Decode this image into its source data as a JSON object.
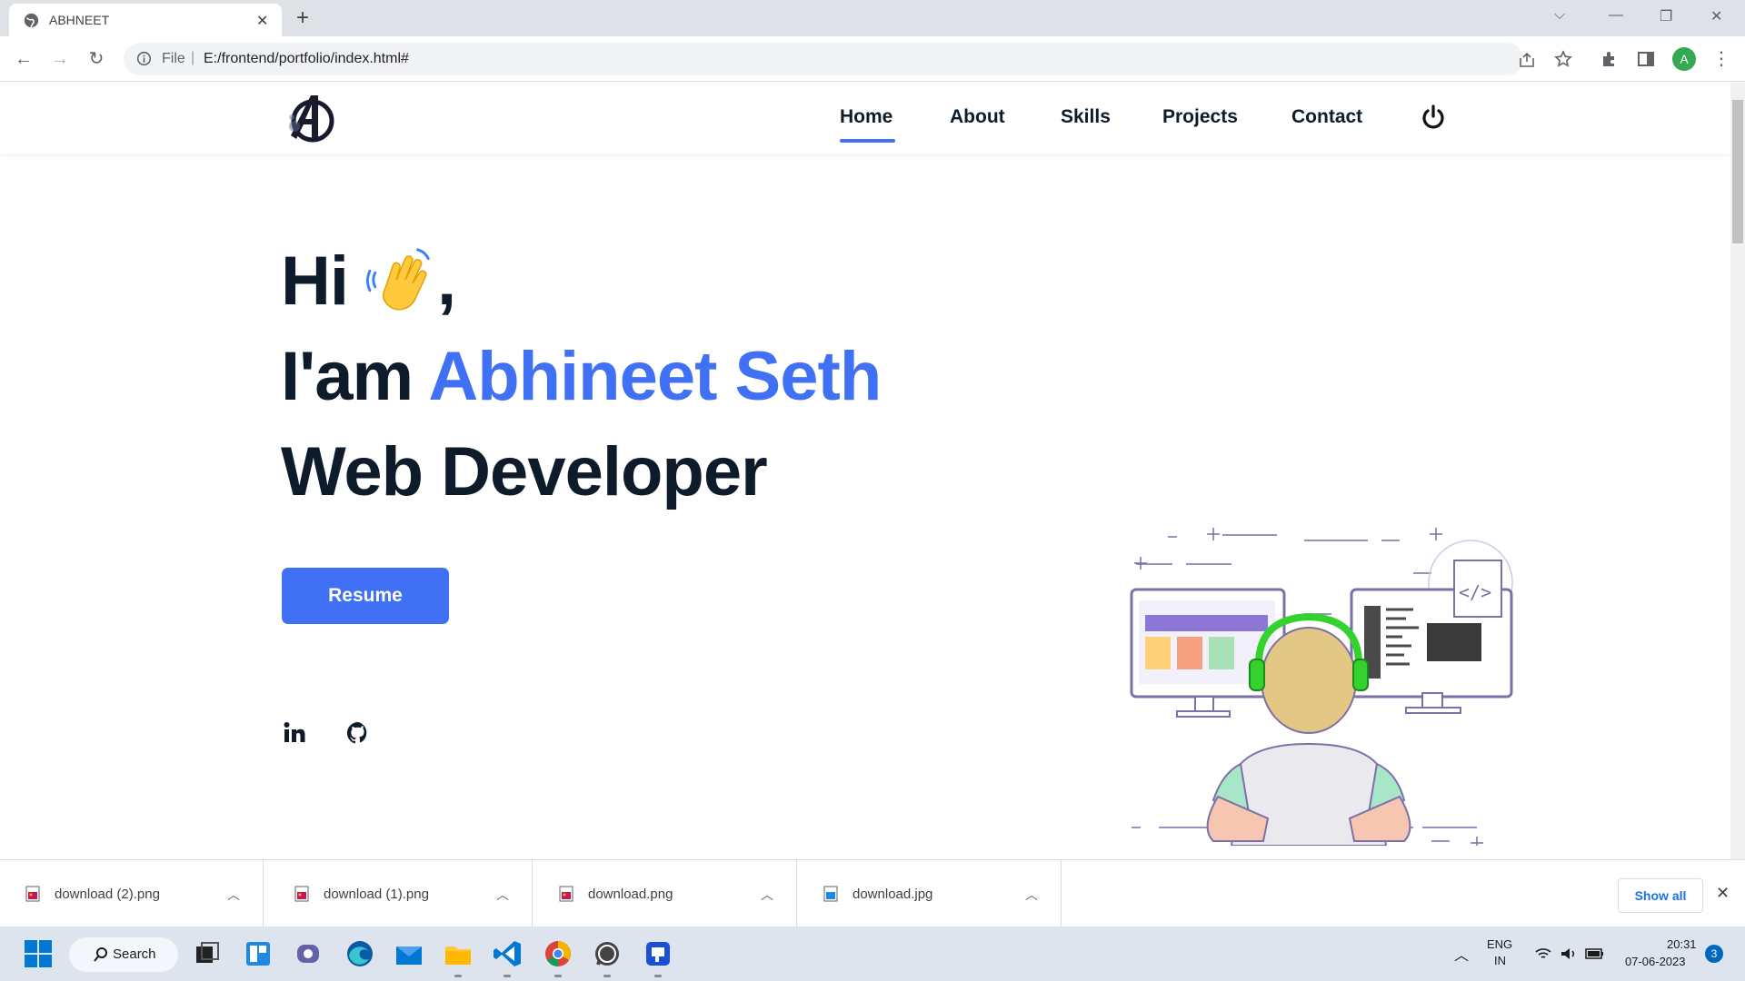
{
  "browser": {
    "tab_title": "ABHNEET",
    "address_scheme": "File",
    "address_url": "E:/frontend/portfolio/index.html#",
    "profile_initial": "A"
  },
  "site": {
    "nav": [
      "Home",
      "About",
      "Skills",
      "Projects",
      "Contact"
    ],
    "active_nav": "Home",
    "accent_color": "#4070f4",
    "text_color": "#0d1b2a"
  },
  "hero": {
    "hi_text": "Hi",
    "hi_comma": ",",
    "intro_prefix": "I'am",
    "name": "Abhineet Seth",
    "role": "Web Developer",
    "resume_label": "Resume",
    "wave_emoji_icon": "waving-hand-icon",
    "social_icons": [
      "linkedin-icon",
      "github-icon"
    ]
  },
  "downloads": {
    "items": [
      "download (2).png",
      "download (1).png",
      "download.png",
      "download.jpg"
    ],
    "show_all_label": "Show all"
  },
  "taskbar": {
    "search_label": "Search",
    "lang_top": "ENG",
    "lang_bottom": "IN",
    "time": "20:31",
    "date": "07-06-2023",
    "notification_count": "3"
  }
}
